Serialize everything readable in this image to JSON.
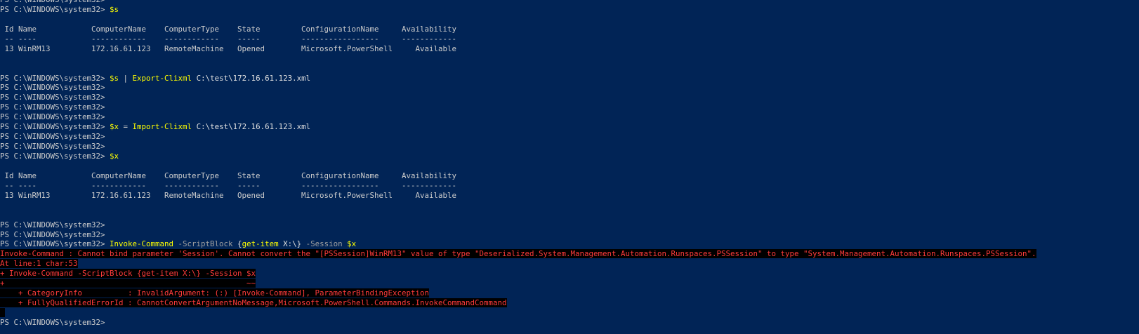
{
  "prompt": "PS C:\\WINDOWS\\system32> ",
  "session_cmd_s": "$s",
  "session_cmd_x": "$x",
  "table": {
    "header": " Id Name            ComputerName    ComputerType    State         ConfigurationName     Availability",
    "divider": " -- ----            ------------    ------------    -----         -----------------     ------------",
    "row": " 13 WinRM13         172.16.61.123   RemoteMachine   Opened        Microsoft.PowerShell     Available"
  },
  "export": {
    "var": "$s",
    "pipe": " | ",
    "cmdlet": "Export-Clixml",
    "arg": " C:\\test\\172.16.61.123.xml"
  },
  "import": {
    "var": "$x",
    "eq": " = ",
    "cmdlet": "Import-Clixml",
    "arg": " C:\\test\\172.16.61.123.xml"
  },
  "invoke": {
    "cmdlet": "Invoke-Command",
    "p1": " -ScriptBlock ",
    "block_open": "{",
    "inner_cmd": "get-item",
    "inner_arg": " X:\\",
    "block_close": "}",
    "p2": " -Session ",
    "var": "$x"
  },
  "error": {
    "line1": "Invoke-Command : Cannot bind parameter 'Session'. Cannot convert the \"[PSSession]WinRM13\" value of type \"Deserialized.System.Management.Automation.Runspaces.PSSession\" to type \"System.Management.Automation.Runspaces.PSSession\".",
    "line2": "At line:1 char:53",
    "line3": "+ Invoke-Command -ScriptBlock {get-item X:\\} -Session $x",
    "line4": "+                                                     ~~",
    "line5": "    + CategoryInfo          : InvalidArgument: (:) [Invoke-Command], ParameterBindingException",
    "line6": "    + FullyQualifiedErrorId : CannotConvertArgumentNoMessage,Microsoft.PowerShell.Commands.InvokeCommandCommand"
  },
  "colors": {
    "background": "#012456",
    "foreground": "#cccccc",
    "command": "#ffff00",
    "parameter": "#a0a0a0",
    "error_fg": "#ff3b3b",
    "error_bg": "#000000"
  }
}
